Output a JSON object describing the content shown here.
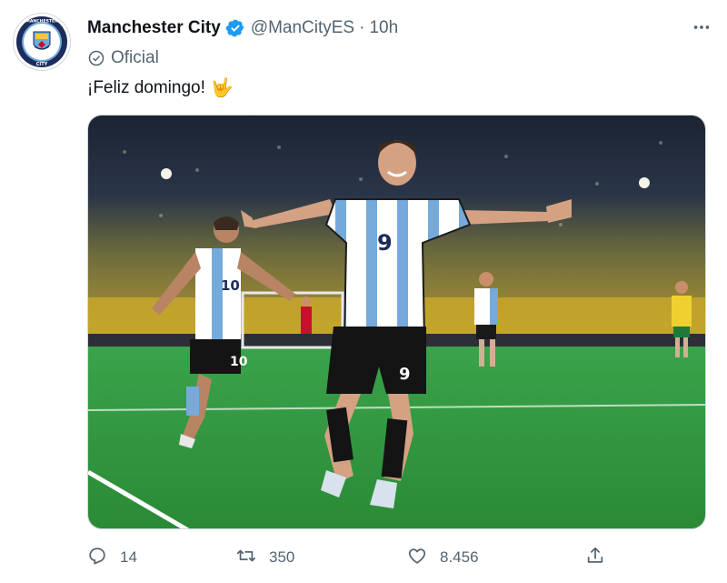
{
  "author": {
    "name": "Manchester City",
    "handle": "@ManCityES",
    "separator": "·",
    "time": "10h",
    "label": "Oficial",
    "avatar_text_top": "MANCHESTER",
    "avatar_text_bottom": "CITY"
  },
  "tweet": {
    "text": "¡Feliz domingo!",
    "emoji": "🤟"
  },
  "media": {
    "player_number_main": "9",
    "player_number_left": "10"
  },
  "actions": {
    "replies": "14",
    "retweets": "350",
    "likes": "8.456"
  },
  "icons": {
    "verified": "verified-badge-icon",
    "label": "check-circle-icon",
    "more": "more-horizontal-icon",
    "reply": "reply-icon",
    "retweet": "retweet-icon",
    "like": "heart-icon",
    "share": "share-icon"
  },
  "colors": {
    "verified_blue": "#1d9bf0",
    "secondary_text": "#536471",
    "primary_text": "#0f1419",
    "pitch_green": "#2f9a3d",
    "city_blue": "#6cabdd"
  }
}
